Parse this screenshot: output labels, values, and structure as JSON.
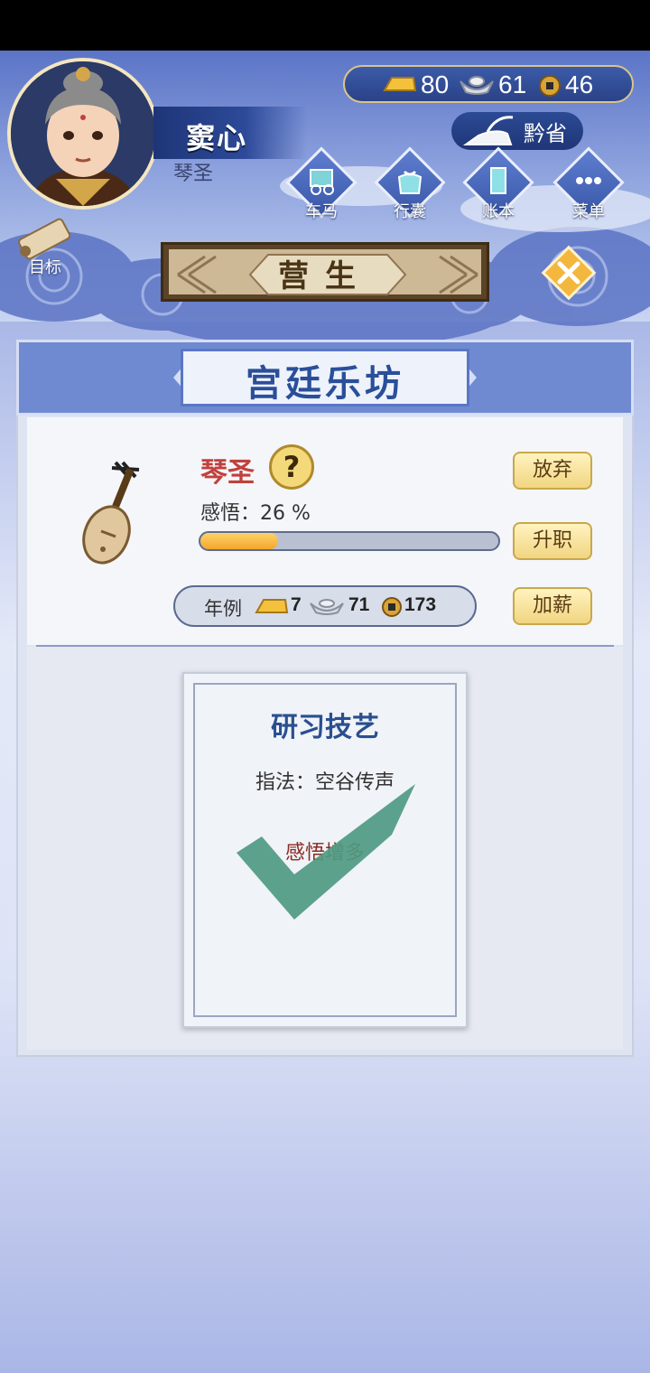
{
  "player": {
    "name": "窦心",
    "title": "琴圣"
  },
  "goal": {
    "label": "目标"
  },
  "currency": {
    "gold": "80",
    "silver": "61",
    "copper": "46"
  },
  "location": {
    "label": "黔省"
  },
  "nav": {
    "items": [
      {
        "label": "车马",
        "icon": "carriage-icon"
      },
      {
        "label": "行囊",
        "icon": "bundle-icon"
      },
      {
        "label": "账本",
        "icon": "ledger-icon"
      },
      {
        "label": "菜单",
        "icon": "menu-dots-icon"
      }
    ]
  },
  "screen": {
    "title": "营生"
  },
  "panel": {
    "title": "宫廷乐坊",
    "job": {
      "name": "琴圣",
      "help": "?"
    },
    "insight": {
      "label": "感悟：26 %",
      "progress": 0.26
    },
    "buttons": {
      "abandon": "放弃",
      "promote": "升职",
      "raise": "加薪"
    },
    "salary": {
      "label": "年例",
      "gold": "7",
      "silver": "71",
      "copper": "173"
    }
  },
  "card": {
    "title": "研习技艺",
    "skill": "指法：空谷传声",
    "effect": "感悟增多",
    "completed": true
  },
  "colors": {
    "accent": "#2a4f9a",
    "job_name": "#c0413d",
    "check": "#4f9a82",
    "progress": "#f2a62c"
  }
}
